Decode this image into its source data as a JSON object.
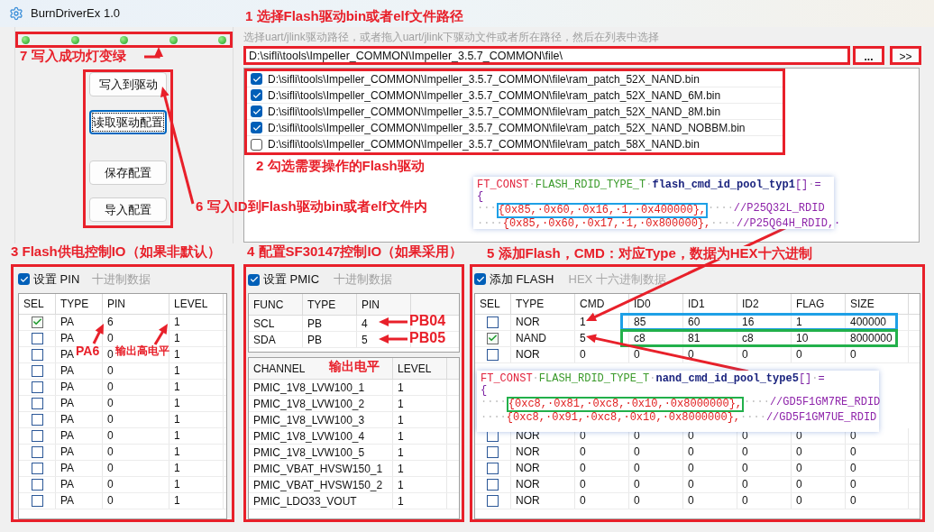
{
  "window": {
    "title": "BurnDriverEx 1.0"
  },
  "leds": [
    {
      "on": true
    },
    {
      "on": true
    },
    {
      "on": true
    },
    {
      "on": true
    },
    {
      "on": true
    }
  ],
  "buttons": [
    {
      "label": "写入到驱动",
      "focused": false
    },
    {
      "label": "读取驱动配置",
      "focused": true
    },
    {
      "label": "保存配置",
      "focused": false
    },
    {
      "label": "导入配置",
      "focused": false
    }
  ],
  "path_hint": "选择uart/jlink驱动路径，或者拖入uart/jlink下驱动文件或者所在路径，然后在列表中选择",
  "path_field": {
    "value": "D:\\sifli\\tools\\Impeller_COMMON\\Impeller_3.5.7_COMMON\\file\\"
  },
  "browse_button": "...",
  "go_button": ">>",
  "files": [
    {
      "path": "D:\\sifli\\tools\\Impeller_COMMON\\Impeller_3.5.7_COMMON\\file\\ram_patch_52X_NAND.bin",
      "checked": true
    },
    {
      "path": "D:\\sifli\\tools\\Impeller_COMMON\\Impeller_3.5.7_COMMON\\file\\ram_patch_52X_NAND_6M.bin",
      "checked": true
    },
    {
      "path": "D:\\sifli\\tools\\Impeller_COMMON\\Impeller_3.5.7_COMMON\\file\\ram_patch_52X_NAND_8M.bin",
      "checked": true
    },
    {
      "path": "D:\\sifli\\tools\\Impeller_COMMON\\Impeller_3.5.7_COMMON\\file\\ram_patch_52X_NAND_NOBBM.bin",
      "checked": true
    },
    {
      "path": "D:\\sifli\\tools\\Impeller_COMMON\\Impeller_3.5.7_COMMON\\file\\ram_patch_58X_NAND.bin",
      "checked": false
    }
  ],
  "code_popups": [
    {
      "lines": [
        [
          {
            "kind": "keyword",
            "text": "FT_CONST"
          },
          {
            "kind": "space",
            "text": "·"
          },
          {
            "kind": "type",
            "text": "FLASH_RDID_TYPE_T"
          },
          {
            "kind": "space",
            "text": "·"
          },
          {
            "kind": "ident",
            "text": "flash_cmd_id_pool_typ1"
          },
          {
            "kind": "punct",
            "text": "[]"
          },
          {
            "kind": "space",
            "text": "·"
          },
          {
            "kind": "punct",
            "text": "="
          }
        ],
        [
          {
            "kind": "punct",
            "text": "{"
          }
        ],
        [
          {
            "kind": "space",
            "text": "···"
          },
          {
            "kind": "number",
            "text": "{0x85,·0x60,·0x16,·1,·0x400000},",
            "color": "#1ea0e6"
          },
          {
            "kind": "space",
            "text": "····"
          },
          {
            "kind": "comment",
            "text": "//P25Q32L_RDID"
          }
        ],
        [
          {
            "kind": "space",
            "text": "····"
          },
          {
            "kind": "number",
            "text": "{0x85,·0x60,·0x17,·1,·0x800000},"
          },
          {
            "kind": "space",
            "text": "····"
          },
          {
            "kind": "comment",
            "text": "//P25Q64H_RDID,·"
          }
        ]
      ]
    },
    {
      "lines": [
        [
          {
            "kind": "keyword",
            "text": "FT_CONST"
          },
          {
            "kind": "space",
            "text": "·"
          },
          {
            "kind": "type",
            "text": "FLASH_RDID_TYPE_T"
          },
          {
            "kind": "space",
            "text": "·"
          },
          {
            "kind": "ident",
            "text": "nand_cmd_id_pool_type5"
          },
          {
            "kind": "punct",
            "text": "[]"
          },
          {
            "kind": "space",
            "text": "·"
          },
          {
            "kind": "punct",
            "text": "="
          }
        ],
        [
          {
            "kind": "punct",
            "text": "{"
          }
        ],
        [
          {
            "kind": "space",
            "text": "····"
          },
          {
            "kind": "number",
            "text": "{0xc8,·0x81,·0xc8,·0x10,·0x8000000},",
            "color": "#22b04b"
          },
          {
            "kind": "space",
            "text": "····"
          },
          {
            "kind": "comment",
            "text": "//GD5F1GM7RE_RDID"
          }
        ],
        [
          {
            "kind": "space",
            "text": "····"
          },
          {
            "kind": "number",
            "text": "{0xc8,·0x91,·0xc8,·0x10,·0x8000000},"
          },
          {
            "kind": "space",
            "text": "····"
          },
          {
            "kind": "comment",
            "text": "//GD5F1GM7UE_RDID"
          }
        ]
      ]
    }
  ],
  "power_panel": {
    "checkbox": {
      "label": "设置 PIN",
      "checked": true
    },
    "hint": "十进制数据",
    "columns": [
      "SEL",
      "TYPE",
      "PIN",
      "LEVEL"
    ],
    "rows": [
      {
        "selected": true,
        "type": "PA",
        "pin": "6",
        "level": "1"
      },
      {
        "selected": false,
        "type": "PA",
        "pin": "0",
        "level": "1"
      },
      {
        "selected": false,
        "type": "PA",
        "pin": "0",
        "level": "1"
      },
      {
        "selected": false,
        "type": "PA",
        "pin": "0",
        "level": "1"
      },
      {
        "selected": false,
        "type": "PA",
        "pin": "0",
        "level": "1"
      },
      {
        "selected": false,
        "type": "PA",
        "pin": "0",
        "level": "1"
      },
      {
        "selected": false,
        "type": "PA",
        "pin": "0",
        "level": "1"
      },
      {
        "selected": false,
        "type": "PA",
        "pin": "0",
        "level": "1"
      },
      {
        "selected": false,
        "type": "PA",
        "pin": "0",
        "level": "1"
      },
      {
        "selected": false,
        "type": "PA",
        "pin": "0",
        "level": "1"
      },
      {
        "selected": false,
        "type": "PA",
        "pin": "0",
        "level": "1"
      },
      {
        "selected": false,
        "type": "PA",
        "pin": "0",
        "level": "1"
      }
    ]
  },
  "pmic_panel": {
    "checkbox": {
      "label": "设置 PMIC",
      "checked": true
    },
    "hint": "十进制数据",
    "pin_table": {
      "columns": [
        "FUNC",
        "TYPE",
        "PIN"
      ],
      "rows": [
        [
          "SCL",
          "PB",
          "4"
        ],
        [
          "SDA",
          "PB",
          "5"
        ]
      ]
    },
    "channel_table": {
      "columns": [
        "CHANNEL",
        "LEVEL"
      ],
      "rows": [
        [
          "PMIC_1V8_LVW100_1",
          "1"
        ],
        [
          "PMIC_1V8_LVW100_2",
          "1"
        ],
        [
          "PMIC_1V8_LVW100_3",
          "1"
        ],
        [
          "PMIC_1V8_LVW100_4",
          "1"
        ],
        [
          "PMIC_1V8_LVW100_5",
          "1"
        ],
        [
          "PMIC_VBAT_HVSW150_1",
          "1"
        ],
        [
          "PMIC_VBAT_HVSW150_2",
          "1"
        ],
        [
          "PMIC_LDO33_VOUT",
          "1"
        ]
      ]
    }
  },
  "flash_panel": {
    "checkbox": {
      "label": "添加 FLASH",
      "checked": true
    },
    "hint": "HEX 十六进制数据",
    "columns": [
      "SEL",
      "TYPE",
      "CMD",
      "ID0",
      "ID1",
      "ID2",
      "FLAG",
      "SIZE"
    ],
    "rows_above": [
      {
        "selected": false,
        "cells": [
          "NOR",
          "1",
          "85",
          "60",
          "16",
          "1",
          "400000"
        ],
        "color": "#1ea0e6"
      },
      {
        "selected": true,
        "cells": [
          "NAND",
          "5",
          "c8",
          "81",
          "c8",
          "10",
          "8000000"
        ],
        "color": "#22b04b"
      },
      {
        "selected": false,
        "cells": [
          "NOR",
          "0",
          "0",
          "0",
          "0",
          "0",
          "0"
        ]
      }
    ],
    "rows_below": [
      {
        "selected": false,
        "cells": [
          "NOR",
          "0",
          "0",
          "0",
          "0",
          "0",
          "0"
        ]
      },
      {
        "selected": false,
        "cells": [
          "NOR",
          "0",
          "0",
          "0",
          "0",
          "0",
          "0"
        ]
      },
      {
        "selected": false,
        "cells": [
          "NOR",
          "0",
          "0",
          "0",
          "0",
          "0",
          "0"
        ]
      },
      {
        "selected": false,
        "cells": [
          "NOR",
          "0",
          "0",
          "0",
          "0",
          "0",
          "0"
        ]
      },
      {
        "selected": false,
        "cells": [
          "NOR",
          "0",
          "0",
          "0",
          "0",
          "0",
          "0"
        ]
      }
    ]
  },
  "annotations": [
    {
      "text": "1 选择Flash驱动bin或者elf文件路径"
    },
    {
      "text": "7 写入成功灯变绿"
    },
    {
      "text": "2 勾选需要操作的Flash驱动"
    },
    {
      "text": "6 写入ID到Flash驱动bin或者elf文件内"
    },
    {
      "text": "3 Flash供电控制IO（如果非默认）"
    },
    {
      "text": "4 配置SF30147控制IO（如果采用）"
    },
    {
      "text": "5 添加Flash，CMD：对应Type，数据为HEX十六进制"
    },
    {
      "text": "PA6"
    },
    {
      "text": "输出高电平"
    },
    {
      "text": "PB04"
    },
    {
      "text": "PB05"
    },
    {
      "text": "输出电平"
    }
  ]
}
